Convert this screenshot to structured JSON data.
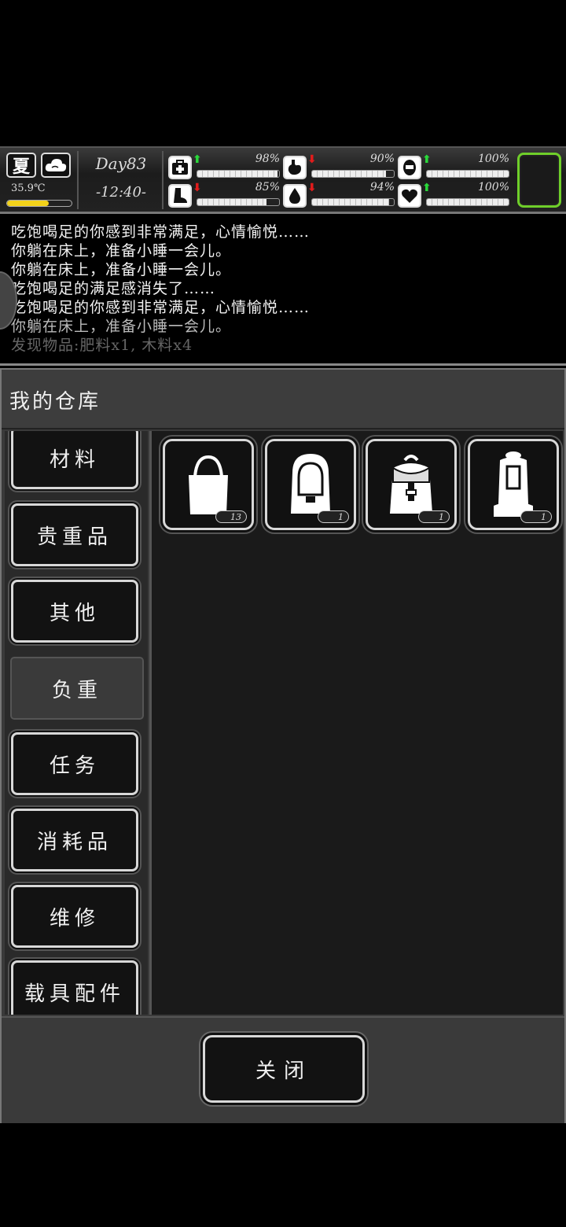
{
  "status": {
    "season": "夏",
    "temperature": "35.9℃",
    "temperature_level": 0.65,
    "day": "Day83",
    "time": "-12:40-",
    "stats": [
      {
        "icon": "medkit-icon",
        "trend": "up",
        "value": "98%",
        "level": 0.98
      },
      {
        "icon": "stomach-icon",
        "trend": "down",
        "value": "90%",
        "level": 0.9
      },
      {
        "icon": "mood-icon",
        "trend": "up",
        "value": "100%",
        "level": 1.0
      },
      {
        "icon": "boot-icon",
        "trend": "down",
        "value": "85%",
        "level": 0.85
      },
      {
        "icon": "water-drop-icon",
        "trend": "down",
        "value": "94%",
        "level": 0.94
      },
      {
        "icon": "heart-icon",
        "trend": "up",
        "value": "100%",
        "level": 1.0
      }
    ]
  },
  "log": [
    "吃饱喝足的你感到非常满足，心情愉悦……",
    "你躺在床上，准备小睡一会儿。",
    "你躺在床上，准备小睡一会儿。",
    "吃饱喝足的满足感消失了……",
    "吃饱喝足的你感到非常满足，心情愉悦……",
    "你躺在床上，准备小睡一会儿。",
    "发现物品:肥料x1, 木料x4"
  ],
  "panel": {
    "title": "我的仓库",
    "categories": [
      "材料",
      "贵重品",
      "其他",
      "负重",
      "任务",
      "消耗品",
      "维修",
      "载具配件"
    ],
    "active_category": "负重",
    "items": [
      {
        "icon": "tote-bag-icon",
        "count": "13"
      },
      {
        "icon": "school-backpack-icon",
        "count": "1"
      },
      {
        "icon": "rucksack-icon",
        "count": "1"
      },
      {
        "icon": "hiking-backpack-icon",
        "count": "1"
      }
    ],
    "close_label": "关闭"
  },
  "colors": {
    "up_arrow": "#29d93a",
    "down_arrow": "#e21b1b",
    "equip_border": "#6fcf2a",
    "temp_fill": "#f2d21a"
  }
}
